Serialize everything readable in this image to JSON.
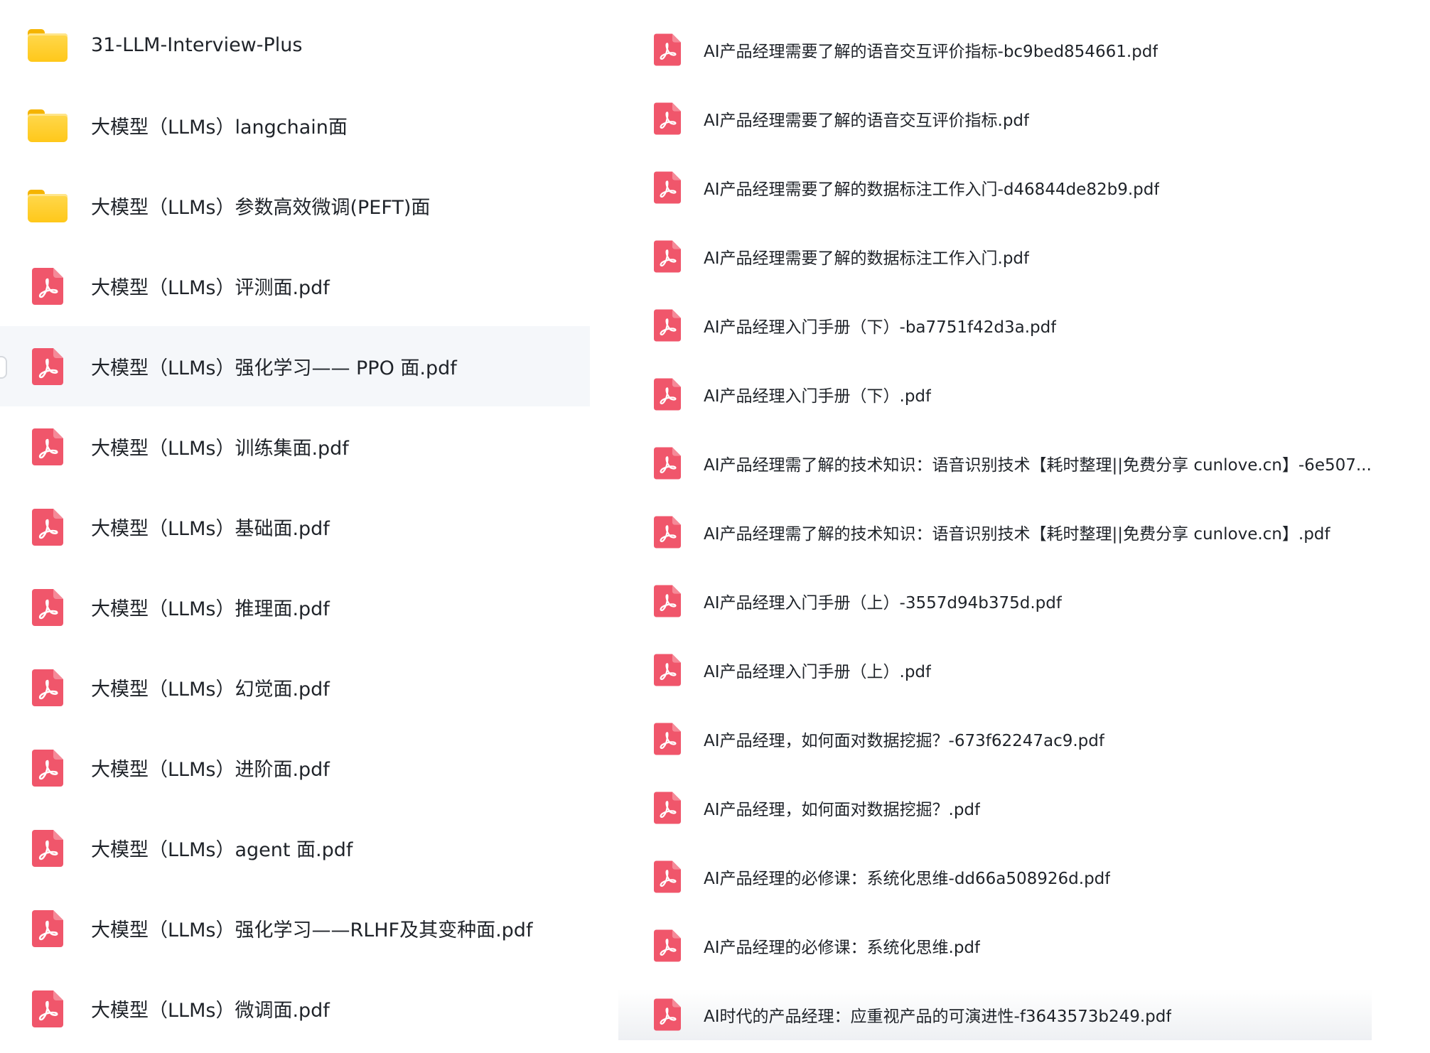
{
  "left": {
    "items": [
      {
        "type": "folder",
        "name": "31-LLM-Interview-Plus"
      },
      {
        "type": "folder",
        "name": "大模型（LLMs）langchain面"
      },
      {
        "type": "folder",
        "name": "大模型（LLMs）参数高效微调(PEFT)面"
      },
      {
        "type": "pdf",
        "name": "大模型（LLMs）评测面.pdf"
      },
      {
        "type": "pdf",
        "name": "大模型（LLMs）强化学习—— PPO 面.pdf",
        "selected": true
      },
      {
        "type": "pdf",
        "name": "大模型（LLMs）训练集面.pdf"
      },
      {
        "type": "pdf",
        "name": "大模型（LLMs）基础面.pdf"
      },
      {
        "type": "pdf",
        "name": "大模型（LLMs）推理面.pdf"
      },
      {
        "type": "pdf",
        "name": "大模型（LLMs）幻觉面.pdf"
      },
      {
        "type": "pdf",
        "name": "大模型（LLMs）进阶面.pdf"
      },
      {
        "type": "pdf",
        "name": "大模型（LLMs）agent 面.pdf"
      },
      {
        "type": "pdf",
        "name": "大模型（LLMs）强化学习——RLHF及其变种面.pdf"
      },
      {
        "type": "pdf",
        "name": "大模型（LLMs）微调面.pdf"
      }
    ]
  },
  "right": {
    "items": [
      {
        "type": "pdf",
        "name": "AI产品经理需要了解的语音交互评价指标-bc9bed854661.pdf"
      },
      {
        "type": "pdf",
        "name": "AI产品经理需要了解的语音交互评价指标.pdf"
      },
      {
        "type": "pdf",
        "name": "AI产品经理需要了解的数据标注工作入门-d46844de82b9.pdf"
      },
      {
        "type": "pdf",
        "name": "AI产品经理需要了解的数据标注工作入门.pdf"
      },
      {
        "type": "pdf",
        "name": "AI产品经理入门手册（下）-ba7751f42d3a.pdf"
      },
      {
        "type": "pdf",
        "name": "AI产品经理入门手册（下）.pdf"
      },
      {
        "type": "pdf",
        "name": "AI产品经理需了解的技术知识：语音识别技术【耗时整理||免费分享 cunlove.cn】-6e507..."
      },
      {
        "type": "pdf",
        "name": "AI产品经理需了解的技术知识：语音识别技术【耗时整理||免费分享 cunlove.cn】.pdf"
      },
      {
        "type": "pdf",
        "name": "AI产品经理入门手册（上）-3557d94b375d.pdf"
      },
      {
        "type": "pdf",
        "name": "AI产品经理入门手册（上）.pdf"
      },
      {
        "type": "pdf",
        "name": "AI产品经理，如何面对数据挖掘？-673f62247ac9.pdf"
      },
      {
        "type": "pdf",
        "name": "AI产品经理，如何面对数据挖掘？.pdf"
      },
      {
        "type": "pdf",
        "name": "AI产品经理的必修课：系统化思维-dd66a508926d.pdf"
      },
      {
        "type": "pdf",
        "name": "AI产品经理的必修课：系统化思维.pdf"
      },
      {
        "type": "pdf",
        "name": "AI时代的产品经理：应重视产品的可演进性-f3643573b249.pdf",
        "faded": true
      }
    ]
  },
  "colors": {
    "pdf_icon": "#f0566b",
    "folder": "#ffc81a",
    "selected_row": "#f5f7fa",
    "text": "#1f2329"
  }
}
